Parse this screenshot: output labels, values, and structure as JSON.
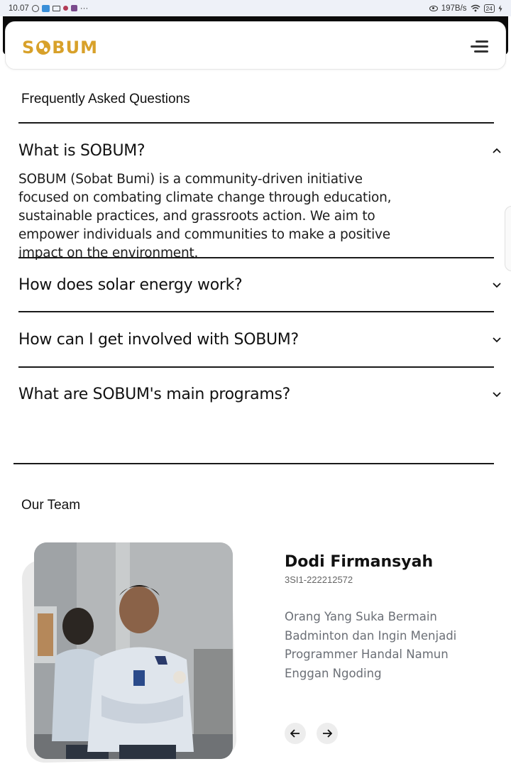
{
  "status_bar": {
    "time": "10.07",
    "left_icons": [
      "whatsapp-icon",
      "chat-icon",
      "mail-icon",
      "app-icon",
      "app-icon"
    ],
    "more": "···",
    "network_speed": "197B/s",
    "battery": "24"
  },
  "header": {
    "logo_left": "S",
    "logo_right": "BUM"
  },
  "faq": {
    "title": "Frequently Asked Questions",
    "items": [
      {
        "question": "What is SOBUM?",
        "expanded": true,
        "answer": "SOBUM (Sobat Bumi) is a community-driven initiative focused on combating climate change through education, sustainable practices, and grassroots action. We aim to empower individuals and communities to make a positive impact on the environment."
      },
      {
        "question": "How does solar energy work?",
        "expanded": false
      },
      {
        "question": "How can I get involved with SOBUM?",
        "expanded": false
      },
      {
        "question": "What are SOBUM's main programs?",
        "expanded": false
      }
    ]
  },
  "team": {
    "title": "Our Team",
    "member": {
      "name": "Dodi Firmansyah",
      "id": "3SI1-222212572",
      "bio": "Orang Yang Suka Bermain Badminton dan Ingin Menjadi Programmer Handal Namun Enggan Ngoding"
    }
  },
  "colors": {
    "brand": "#d8a12a",
    "divider": "#1a1a1a",
    "bio_text": "#6b6f76"
  }
}
